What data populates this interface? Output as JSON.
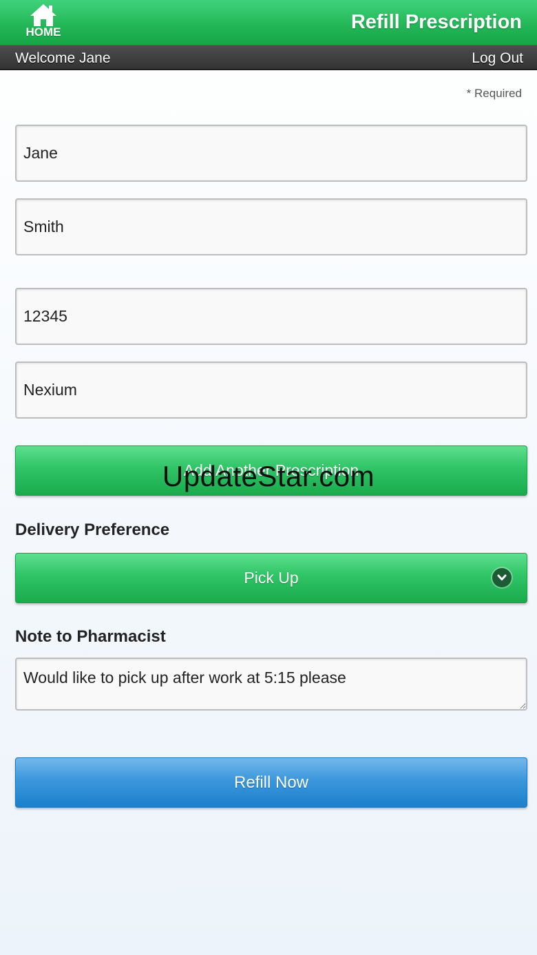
{
  "header": {
    "home_label": "HOME",
    "title": "Refill Prescription"
  },
  "subbar": {
    "welcome": "Welcome Jane",
    "logout": "Log Out"
  },
  "form": {
    "required_note": "* Required",
    "first_name": "Jane",
    "last_name": "Smith",
    "rx_number": "12345",
    "medication": "Nexium",
    "add_button": "Add Another Prescription",
    "delivery_label": "Delivery Preference",
    "delivery_value": "Pick Up",
    "note_label": "Note to Pharmacist",
    "note_value": "Would like to pick up after work at 5:15 please",
    "submit_button": "Refill Now"
  },
  "watermark": "UpdateStar.com",
  "colors": {
    "header_green": "#22b556",
    "button_blue": "#3b97dc",
    "subbar_dark": "#333333"
  },
  "icons": {
    "home": "home-icon",
    "dropdown": "chevron-down-icon"
  }
}
